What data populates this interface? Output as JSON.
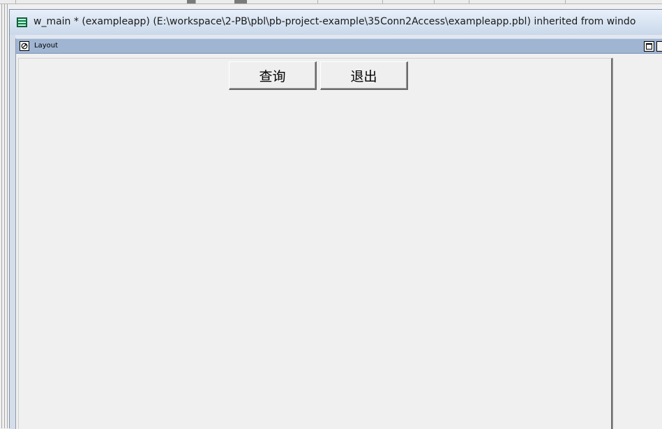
{
  "mdi_window": {
    "title": "w_main * (exampleapp) (E:\\workspace\\2-PB\\pbl\\pb-project-example\\35Conn2Access\\exampleapp.pbl) inherited from windo",
    "icon": "window-icon"
  },
  "layout_pane": {
    "title": "Layout",
    "icon": "layout-pane-icon"
  },
  "design_surface": {
    "buttons": [
      {
        "label": "查询"
      },
      {
        "label": "退出"
      }
    ]
  },
  "colors": {
    "titlebar_top": "#e8f0fa",
    "titlebar_bottom": "#c9d8ea",
    "pane_header": "#9fb5d2",
    "surface": "#f0f0f0"
  }
}
